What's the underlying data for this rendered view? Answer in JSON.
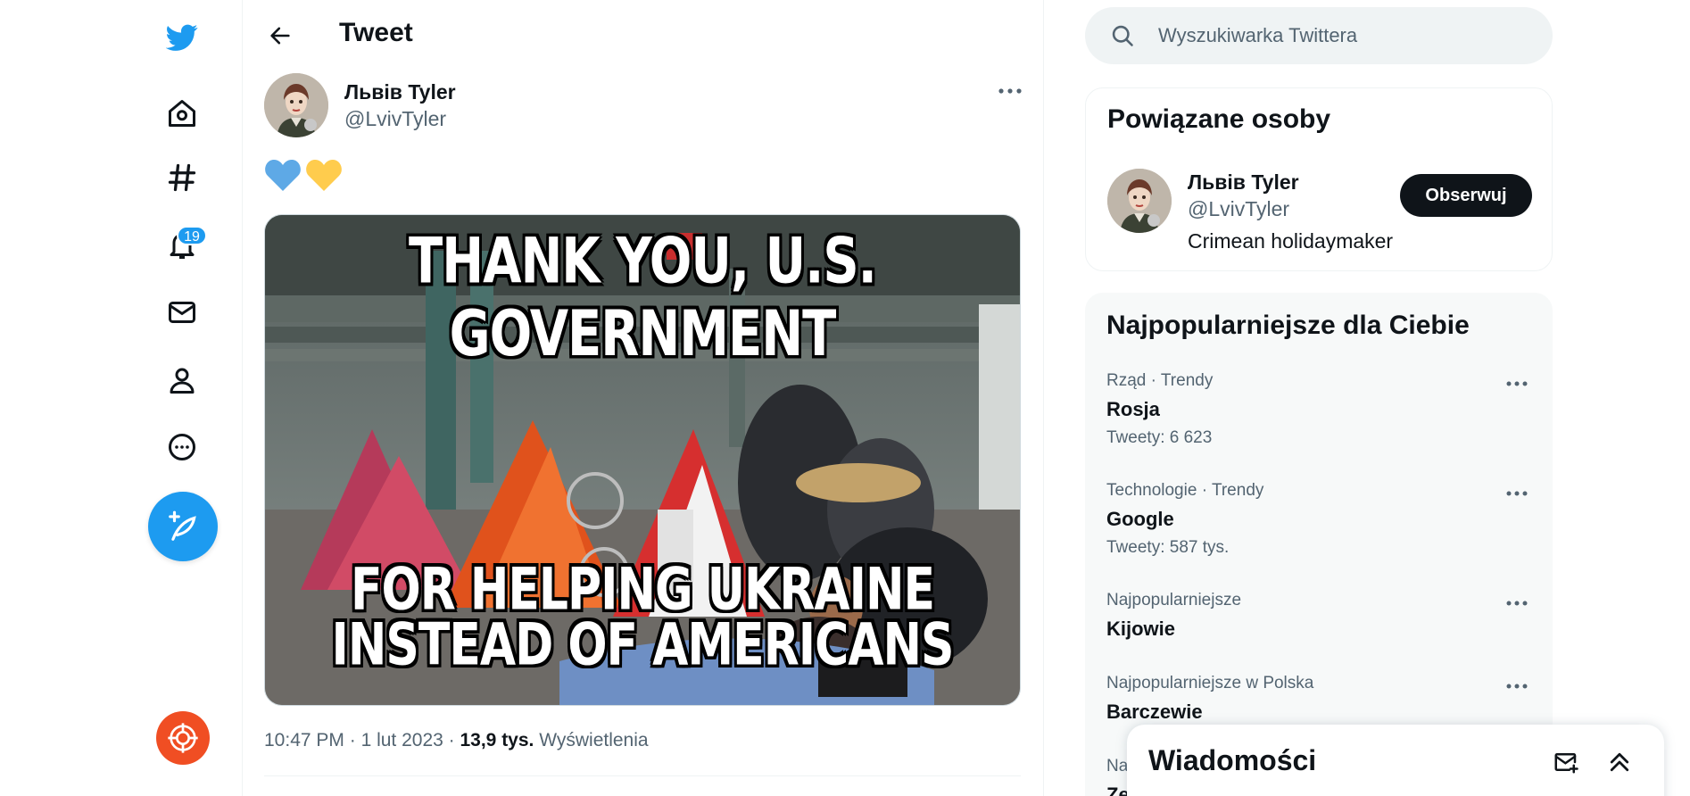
{
  "nav": {
    "items": [
      {
        "name": "twitter-logo-icon"
      },
      {
        "name": "home-icon"
      },
      {
        "name": "explore-hashtag-icon"
      },
      {
        "name": "notifications-bell-icon",
        "badge": "19"
      },
      {
        "name": "messages-envelope-icon"
      },
      {
        "name": "profile-person-icon"
      },
      {
        "name": "more-circle-icon"
      }
    ],
    "compose_icon": "feather-plus-icon",
    "extension_icon": "target-crosshair-icon"
  },
  "header": {
    "title": "Tweet"
  },
  "tweet": {
    "author_name": "Львів Tyler",
    "author_handle": "@LvivTyler",
    "text_emoji": [
      "blue-heart",
      "yellow-heart"
    ],
    "image_text_top": "THANK YOU, U.S. GOVERNMENT",
    "image_text_bottom_1": "FOR HELPING UKRAINE",
    "image_text_bottom_2": "INSTEAD OF AMERICANS",
    "time": "10:47 PM",
    "date": "1 lut 2023",
    "views_count": "13,9 tys.",
    "views_label": "Wyświetlenia"
  },
  "search": {
    "placeholder": "Wyszukiwarka Twittera"
  },
  "related": {
    "title": "Powiązane osoby",
    "person": {
      "name": "Львів Tyler",
      "handle": "@LvivTyler",
      "bio": "Crimean holidaymaker",
      "follow_label": "Obserwuj"
    }
  },
  "trends": {
    "title": "Najpopularniejsze dla Ciebie",
    "items": [
      {
        "context": "Rząd · Trendy",
        "topic": "Rosja",
        "count": "Tweety: 6 623"
      },
      {
        "context": "Technologie · Trendy",
        "topic": "Google",
        "count": "Tweety: 587 tys."
      },
      {
        "context": "Najpopularniejsze",
        "topic": "Kijowie",
        "count": ""
      },
      {
        "context": "Najpopularniejsze w Polska",
        "topic": "Barczewie",
        "count": ""
      },
      {
        "context": "Na",
        "topic": "Ze",
        "count": ""
      }
    ]
  },
  "messages_drawer": {
    "title": "Wiadomości"
  },
  "colors": {
    "accent": "#1d9bf0",
    "text": "#0f1419",
    "secondary": "#536471",
    "heart_blue": "#5ea9e6",
    "heart_yellow": "#ffcc4d"
  }
}
